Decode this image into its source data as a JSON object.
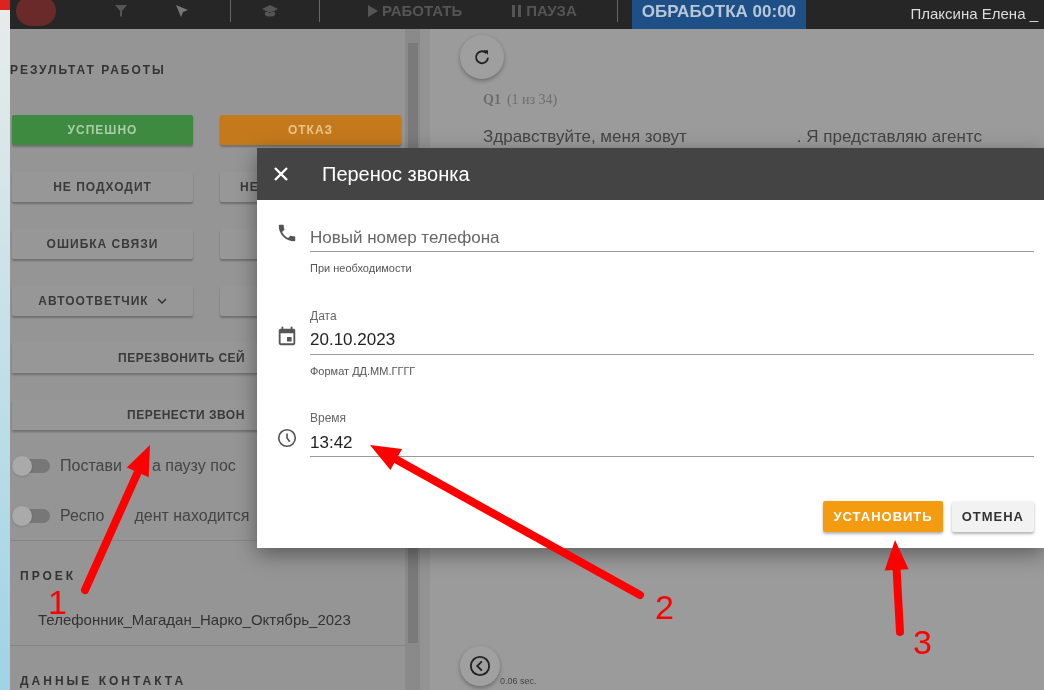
{
  "top_bar": {
    "items": [
      {
        "label": "РАБОТАТЬ",
        "kind": "play"
      },
      {
        "label": "ПАУЗА",
        "kind": "pause"
      }
    ],
    "status": "ОБРАБОТКА 00:00",
    "user": "Плаксина Елена _"
  },
  "left_panel": {
    "title": "РЕЗУЛЬТАТ РАБОТЫ",
    "buttons": [
      {
        "label": "УСПЕШНО",
        "kind": "success"
      },
      {
        "label": "ОТКАЗ",
        "kind": "refuse"
      },
      {
        "label": "НЕ ПОДХОДИТ",
        "kind": "plain"
      },
      {
        "label": "НЕ",
        "kind": "cut"
      },
      {
        "label": "ОШИБКА СВЯЗИ",
        "kind": "plain"
      },
      {
        "kind": "plain"
      },
      {
        "label": "АВТООТВЕТЧИК",
        "kind": "dropdown"
      },
      {
        "kind": "plain"
      }
    ],
    "wide_buttons": [
      "ПЕРЕЗВОНИТЬ СЕЙ",
      "ПЕРЕНЕСТИ ЗВОН"
    ],
    "toggles": [
      {
        "label_parts": [
          "Постави",
          "а паузу пос"
        ],
        "on": false
      },
      {
        "label_parts": [
          "Респо",
          "дент находится"
        ],
        "on": false
      }
    ],
    "sections": [
      {
        "title": "ПРОЕК",
        "value": "Телефонник_Магадан_Нарко_Октябрь_2023"
      },
      {
        "title": "ДАННЫЕ КОНТАКТА"
      }
    ]
  },
  "main": {
    "question_number": "Q1",
    "question_count": "(1 из 34)",
    "text_before": "Здравствуйте, меня зовут",
    "text_after": ". Я представляю агентс",
    "timing": "0.06 sec."
  },
  "dialog": {
    "title": "Перенос звонка",
    "fields": [
      {
        "kind": "phone",
        "placeholder": "Новый номер телефона",
        "hint": "При необходимости"
      },
      {
        "kind": "date",
        "label": "Дата",
        "value": "20.10.2023",
        "hint": "Формат ДД.ММ.ГГГГ"
      },
      {
        "kind": "time",
        "label": "Время",
        "value": "13:42"
      }
    ],
    "buttons": [
      {
        "label": "УСТАНОВИТЬ",
        "kind": "primary"
      },
      {
        "label": "ОТМЕНА",
        "kind": "secondary"
      }
    ]
  },
  "annotations": [
    {
      "number": "1"
    },
    {
      "number": "2"
    },
    {
      "number": "3"
    }
  ]
}
